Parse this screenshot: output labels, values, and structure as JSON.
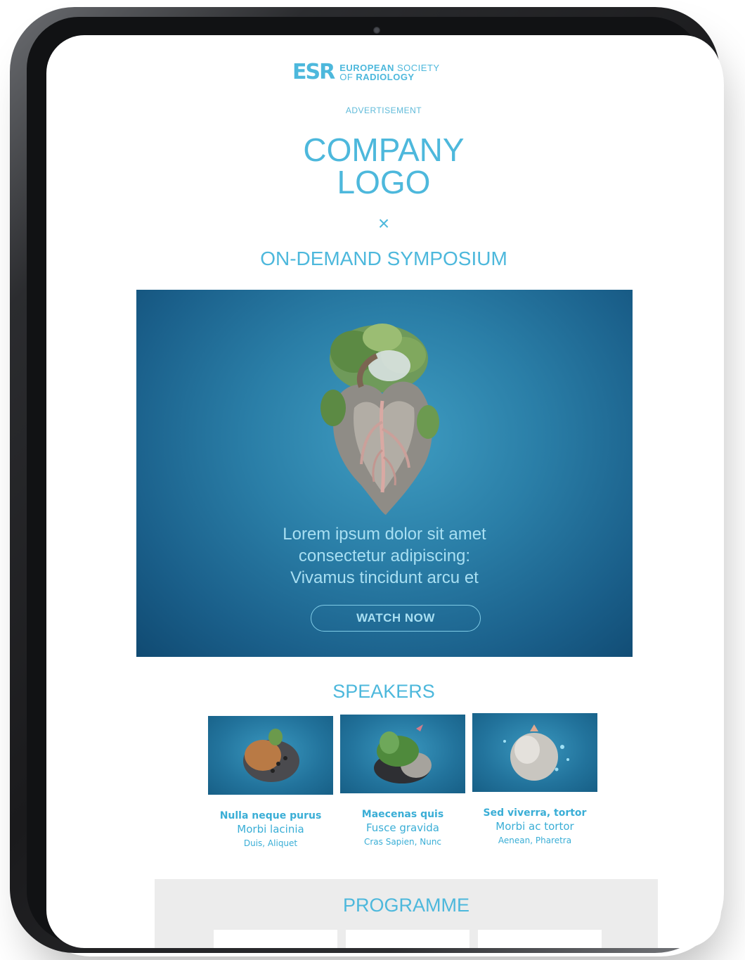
{
  "header": {
    "brand_mark": "ESR",
    "org_line1_bold": "EUROPEAN",
    "org_line1_light": " SOCIETY",
    "org_line2_light": "OF ",
    "org_line2_bold": "RADIOLOGY"
  },
  "advertisement_label": "ADVERTISEMENT",
  "company_logo": "COMPANY\nLOGO",
  "cross_symbol": "×",
  "symposium_title": "ON-DEMAND SYMPOSIUM",
  "hero": {
    "lines": [
      "Lorem ipsum dolor sit amet",
      "consectetur adipiscing:",
      "Vivamus tincidunt arcu et"
    ],
    "button_label": "WATCH NOW"
  },
  "speakers": {
    "title": "SPEAKERS",
    "items": [
      {
        "name": "Nulla neque purus",
        "role": "Morbi lacinia",
        "org": "Duis, Aliquet"
      },
      {
        "name": "Maecenas quis",
        "role": "Fusce gravida",
        "org": "Cras Sapien, Nunc"
      },
      {
        "name": "Sed viverra, tortor",
        "role": "Morbi ac tortor",
        "org": "Aenean, Pharetra"
      }
    ]
  },
  "programme": {
    "title": "PROGRAMME"
  },
  "colors": {
    "accent": "#4db8dc",
    "hero_bg": "#2a7ea7",
    "hero_text": "#a8dff2",
    "programme_bg": "#ececec"
  }
}
